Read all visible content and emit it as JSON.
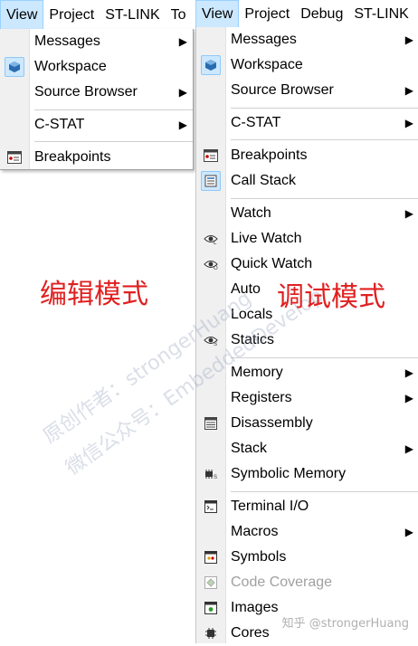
{
  "left": {
    "menubar": [
      {
        "label": "View",
        "active": true
      },
      {
        "label": "Project",
        "active": false
      },
      {
        "label": "ST-LINK",
        "active": false
      },
      {
        "label": "To",
        "active": false
      }
    ],
    "menu": [
      {
        "label": "Messages",
        "icon": "none",
        "submenu": true
      },
      {
        "label": "Workspace",
        "icon": "workspace-icon",
        "submenu": false,
        "checked": true
      },
      {
        "label": "Source Browser",
        "icon": "none",
        "submenu": true
      },
      {
        "label": "C-STAT",
        "icon": "none",
        "submenu": true
      },
      {
        "label": "Breakpoints",
        "icon": "breakpoints-icon",
        "submenu": false
      }
    ],
    "mode_label": "编辑模式"
  },
  "right": {
    "menubar": [
      {
        "label": "View",
        "active": true
      },
      {
        "label": "Project",
        "active": false
      },
      {
        "label": "Debug",
        "active": false
      },
      {
        "label": "ST-LINK",
        "active": false
      }
    ],
    "menu": [
      {
        "label": "Messages",
        "icon": "none",
        "submenu": true
      },
      {
        "label": "Workspace",
        "icon": "workspace-icon",
        "submenu": false,
        "checked": true
      },
      {
        "label": "Source Browser",
        "icon": "none",
        "submenu": true
      },
      {
        "label": "C-STAT",
        "icon": "none",
        "submenu": true
      },
      {
        "label": "Breakpoints",
        "icon": "breakpoints-icon",
        "submenu": false
      },
      {
        "label": "Call Stack",
        "icon": "call-stack-icon",
        "submenu": false,
        "checked": true
      },
      {
        "label": "Watch",
        "icon": "none",
        "submenu": true
      },
      {
        "label": "Live Watch",
        "icon": "live-watch-eye-icon",
        "submenu": false
      },
      {
        "label": "Quick Watch",
        "icon": "quick-watch-eye-icon",
        "submenu": false
      },
      {
        "label": "Auto",
        "icon": "none",
        "submenu": false
      },
      {
        "label": "Locals",
        "icon": "none",
        "submenu": false
      },
      {
        "label": "Statics",
        "icon": "statics-eye-icon",
        "submenu": false
      },
      {
        "label": "Memory",
        "icon": "none",
        "submenu": true
      },
      {
        "label": "Registers",
        "icon": "none",
        "submenu": true
      },
      {
        "label": "Disassembly",
        "icon": "disassembly-icon",
        "submenu": false
      },
      {
        "label": "Stack",
        "icon": "none",
        "submenu": true
      },
      {
        "label": "Symbolic Memory",
        "icon": "symbolic-memory-icon",
        "submenu": false
      },
      {
        "label": "Terminal I/O",
        "icon": "terminal-icon",
        "submenu": false
      },
      {
        "label": "Macros",
        "icon": "none",
        "submenu": true
      },
      {
        "label": "Symbols",
        "icon": "symbols-icon",
        "submenu": false
      },
      {
        "label": "Code Coverage",
        "icon": "code-coverage-icon",
        "submenu": false,
        "disabled": true
      },
      {
        "label": "Images",
        "icon": "images-icon",
        "submenu": false
      },
      {
        "label": "Cores",
        "icon": "cores-icon",
        "submenu": false
      }
    ],
    "mode_label": "调试模式"
  },
  "watermark": {
    "line1": "原创作者：strongerHuang",
    "line2": "微信公众号：EmbeddedDevelop"
  },
  "credit": "知乎 @strongerHuang",
  "colors": {
    "mode_label": "#e02020",
    "highlight": "#cce8ff",
    "submenu_arrow": "#000000"
  }
}
